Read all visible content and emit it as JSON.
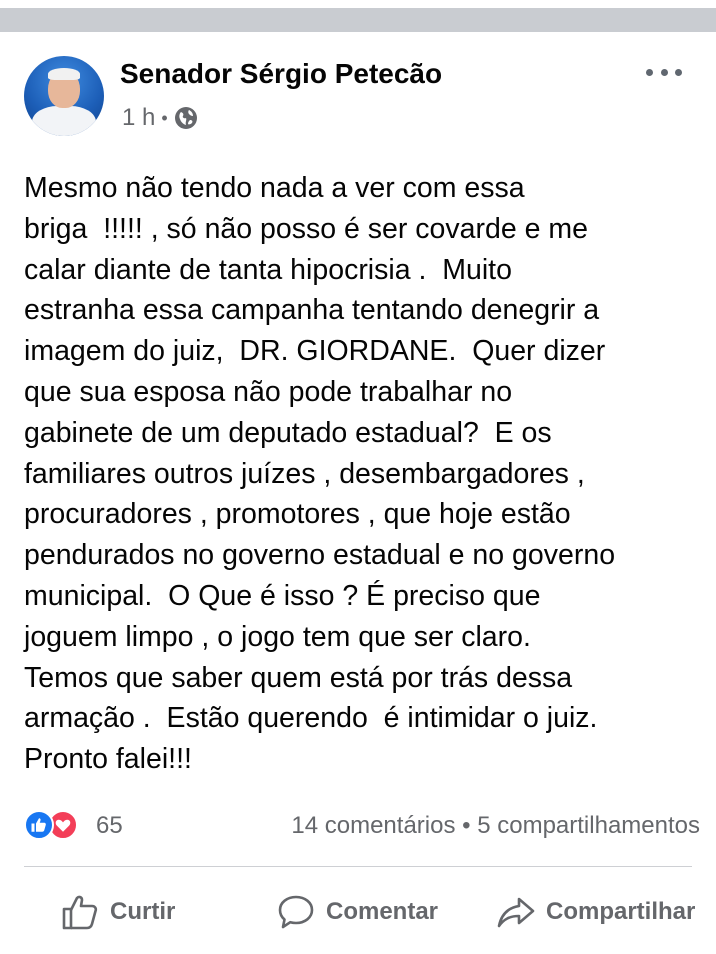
{
  "post": {
    "author": "Senador Sérgio Petecão",
    "time": "1 h",
    "separator": "•",
    "audience_icon": "globe-icon",
    "text": "Mesmo não tendo nada a ver com essa\nbriga  !!!!! , só não posso é ser covarde e me\ncalar diante de tanta hipocrisia .  Muito\nestranha essa campanha tentando denegrir a\nimagem do juiz,  DR. GIORDANE.  Quer dizer\nque sua esposa não pode trabalhar no\ngabinete de um deputado estadual?  E os\nfamiliares outros juízes , desembargadores ,\nprocuradores , promotores , que hoje estão\npendurados no governo estadual e no governo\nmunicipal.  O Que é isso ? É preciso que\njoguem limpo , o jogo tem que ser claro.\nTemos que saber quem está por trás dessa\narmação .  Estão querendo  é intimidar o juiz.\nPronto falei!!!"
  },
  "reactions": {
    "icons": [
      "like-icon",
      "love-icon"
    ],
    "count": "65",
    "comments": "14 comentários",
    "dot": "•",
    "shares": "5 compartilhamentos"
  },
  "actions": {
    "like_label": "Curtir",
    "comment_label": "Comentar",
    "share_label": "Compartilhar"
  },
  "colors": {
    "text": "#050505",
    "secondary": "#65676b",
    "like_blue": "#1877f2",
    "love_red": "#f33e58",
    "divider": "#ced0d4",
    "top_strip": "#c9ccd1"
  }
}
